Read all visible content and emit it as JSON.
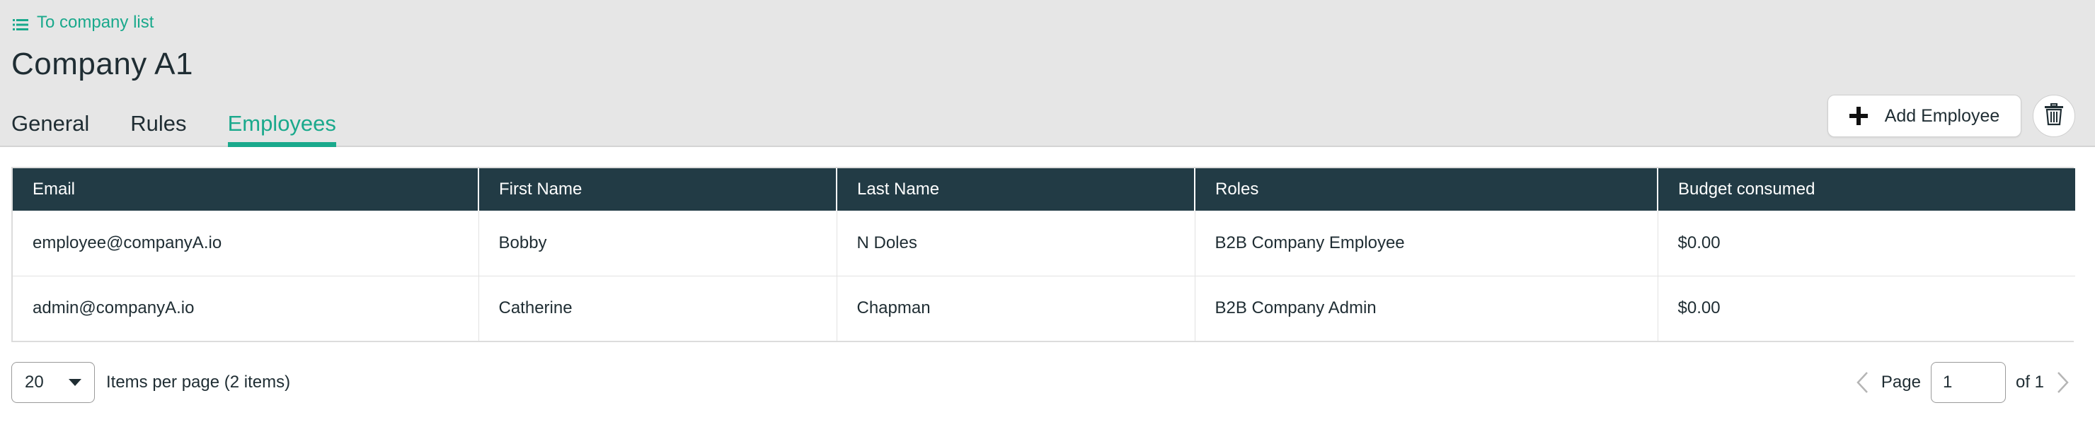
{
  "back_link": {
    "label": "To company list",
    "icon": "list-icon"
  },
  "page_title": "Company A1",
  "tabs": [
    {
      "label": "General",
      "active": false
    },
    {
      "label": "Rules",
      "active": false
    },
    {
      "label": "Employees",
      "active": true
    }
  ],
  "actions": {
    "add_employee_label": "Add Employee",
    "add_icon": "plus-icon",
    "delete_icon": "trash-icon"
  },
  "table": {
    "headers": [
      "Email",
      "First Name",
      "Last Name",
      "Roles",
      "Budget consumed"
    ],
    "rows": [
      [
        "employee@companyA.io",
        "Bobby",
        "N Doles",
        "B2B Company Employee",
        "$0.00"
      ],
      [
        "admin@companyA.io",
        "Catherine",
        "Chapman",
        "B2B Company Admin",
        "$0.00"
      ]
    ]
  },
  "pagination": {
    "items_per_page": "20",
    "items_per_page_label": "Items per page (2 items)",
    "page_label": "Page",
    "current_page": "1",
    "total_label": "of 1"
  },
  "colors": {
    "accent": "#1aa98c",
    "header_bg": "#e6e6e6",
    "table_header_bg": "#223b45"
  }
}
